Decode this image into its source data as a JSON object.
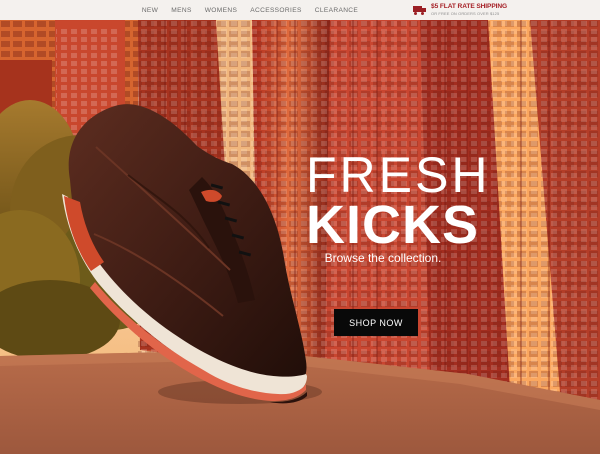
{
  "nav": {
    "items": [
      {
        "label": "NEW"
      },
      {
        "label": "MENS"
      },
      {
        "label": "WOMENS"
      },
      {
        "label": "ACCESSORIES"
      },
      {
        "label": "CLEARANCE"
      }
    ]
  },
  "shipping": {
    "headline": "$5 FLAT RATE SHIPPING",
    "subline": "OR FREE ON ORDERS OVER $125",
    "icon": "truck-icon"
  },
  "hero": {
    "title_line1": "FRESH",
    "title_line2": "KICKS",
    "subtitle": "Browse the collection.",
    "cta": "SHOP NOW",
    "colors": {
      "sky": "#f6b06a",
      "building": "#c8472b",
      "building_dark": "#8b1f17",
      "stone": "#b76e4d",
      "shoe": "#4a241a",
      "sole": "#efe4d6",
      "accent": "#cf4a2b"
    },
    "image": "brown leather sneaker on stone ledge with city buildings"
  }
}
